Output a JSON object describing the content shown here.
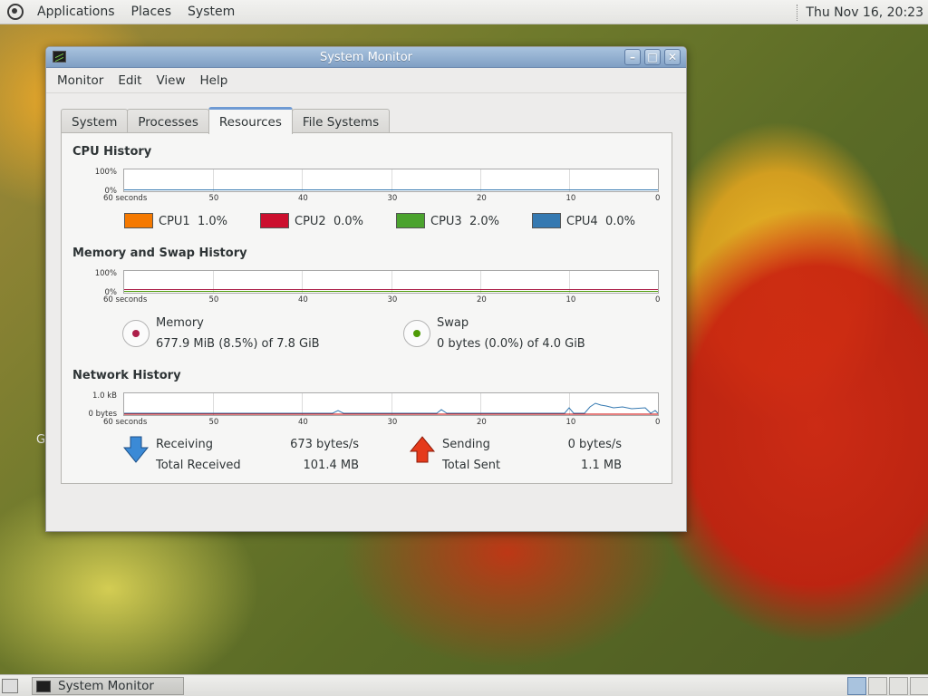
{
  "top_panel": {
    "menus": [
      "Applications",
      "Places",
      "System"
    ],
    "clock": "Thu Nov 16, 20:23"
  },
  "window": {
    "title": "System Monitor",
    "menubar": [
      "Monitor",
      "Edit",
      "View",
      "Help"
    ],
    "tabs": [
      {
        "label": "System",
        "active": false
      },
      {
        "label": "Processes",
        "active": false
      },
      {
        "label": "Resources",
        "active": true
      },
      {
        "label": "File Systems",
        "active": false
      }
    ],
    "x_labels": [
      "60 seconds",
      "50",
      "40",
      "30",
      "20",
      "10",
      "0"
    ],
    "cpu": {
      "title": "CPU History",
      "y_max": "100%",
      "y_min": "0%",
      "legend": [
        {
          "name": "CPU1",
          "value": "1.0%",
          "color": "#f57900"
        },
        {
          "name": "CPU2",
          "value": "0.0%",
          "color": "#cc0f2e"
        },
        {
          "name": "CPU3",
          "value": "2.0%",
          "color": "#4ba32e"
        },
        {
          "name": "CPU4",
          "value": "0.0%",
          "color": "#3579b1"
        }
      ]
    },
    "memory": {
      "title": "Memory and Swap History",
      "y_max": "100%",
      "y_min": "0%",
      "mem_label": "Memory",
      "mem_value": "677.9 MiB (8.5%) of 7.8 GiB",
      "mem_color": "#ad1f4a",
      "swap_label": "Swap",
      "swap_value": "0 bytes (0.0%) of 4.0 GiB",
      "swap_color": "#4e9a06"
    },
    "network": {
      "title": "Network History",
      "y_max": "1.0 kB",
      "y_min": "0 bytes",
      "receiving_label": "Receiving",
      "receiving_value": "673 bytes/s",
      "total_received_label": "Total Received",
      "total_received_value": "101.4 MB",
      "sending_label": "Sending",
      "sending_value": "0 bytes/s",
      "total_sent_label": "Total Sent",
      "total_sent_value": "1.1 MB"
    }
  },
  "taskbar": {
    "items": [
      {
        "label": "System Monitor"
      }
    ]
  },
  "desktop_left_label": "G"
}
